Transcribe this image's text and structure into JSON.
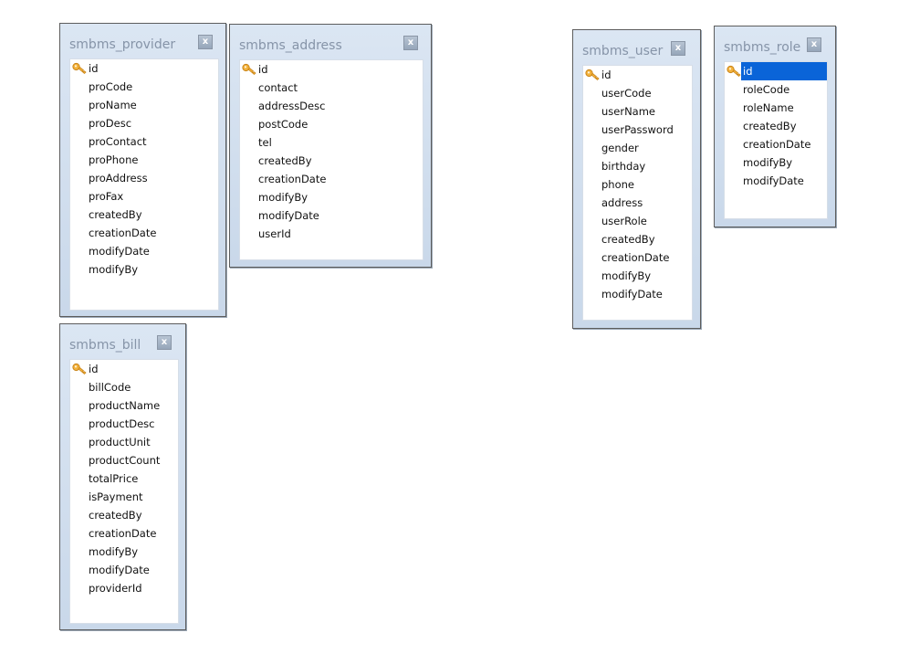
{
  "tables": {
    "provider": {
      "title": "smbms_provider",
      "close_label": "x",
      "fields": [
        "id",
        "proCode",
        "proName",
        "proDesc",
        "proContact",
        "proPhone",
        "proAddress",
        "proFax",
        "createdBy",
        "creationDate",
        "modifyDate",
        "modifyBy"
      ]
    },
    "address": {
      "title": "smbms_address",
      "close_label": "x",
      "fields": [
        "id",
        "contact",
        "addressDesc",
        "postCode",
        "tel",
        "createdBy",
        "creationDate",
        "modifyBy",
        "modifyDate",
        "userId"
      ]
    },
    "bill": {
      "title": "smbms_bill",
      "close_label": "x",
      "fields": [
        "id",
        "billCode",
        "productName",
        "productDesc",
        "productUnit",
        "productCount",
        "totalPrice",
        "isPayment",
        "createdBy",
        "creationDate",
        "modifyBy",
        "modifyDate",
        "providerId"
      ]
    },
    "user": {
      "title": "smbms_user",
      "close_label": "x",
      "fields": [
        "id",
        "userCode",
        "userName",
        "userPassword",
        "gender",
        "birthday",
        "phone",
        "address",
        "userRole",
        "createdBy",
        "creationDate",
        "modifyBy",
        "modifyDate"
      ]
    },
    "role": {
      "title": "smbms_role",
      "close_label": "x",
      "fields": [
        "id",
        "roleCode",
        "roleName",
        "createdBy",
        "creationDate",
        "modifyBy",
        "modifyDate"
      ],
      "selected_field": "id"
    }
  },
  "colors": {
    "card_bg": "#d3dfee",
    "title_text": "#8694a8",
    "selection": "#0a64d8",
    "key_icon": "#f0a030"
  },
  "icons": {
    "primary_key": "key-icon",
    "close": "close-icon"
  }
}
